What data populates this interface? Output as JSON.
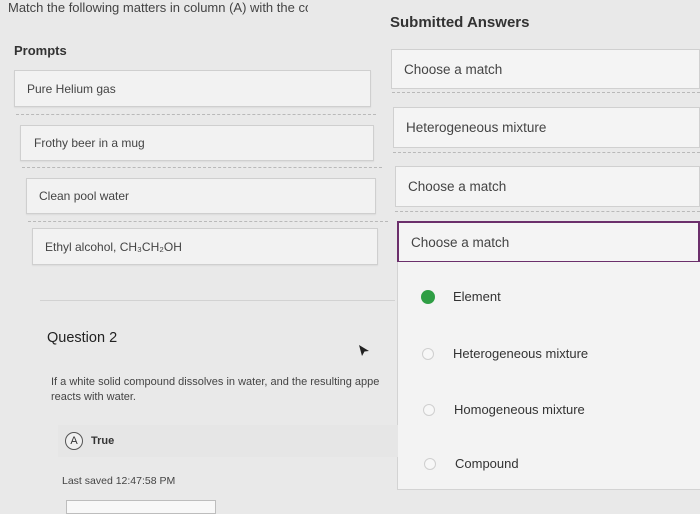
{
  "instructions": "Match the following matters in column (A) with the co",
  "prompts_title": "Prompts",
  "answers_title": "Submitted Answers",
  "prompts": [
    "Pure Helium gas",
    "Frothy beer in a mug",
    "Clean pool water",
    "Ethyl alcohol, CH₃CH₂OH"
  ],
  "answers": [
    "Choose a match",
    "Heterogeneous mixture",
    "Choose a match",
    "Choose a match"
  ],
  "dropdown": {
    "options": [
      "Element",
      "Heterogeneous mixture",
      "Homogeneous mixture",
      "Compound"
    ],
    "selected": "Element"
  },
  "question": {
    "title": "Question 2",
    "text": "If a white solid compound dissolves in water, and the resulting appe reacts with water.",
    "answer_letter": "A",
    "answer_text": "True"
  },
  "last_saved": "Last saved 12:47:58 PM",
  "colors": {
    "accent": "#6b2f6b",
    "selected_radio": "#2f9e44"
  }
}
